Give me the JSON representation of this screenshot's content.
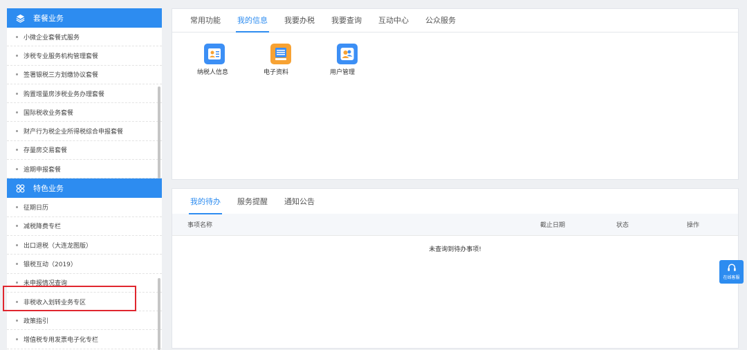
{
  "sidebar": {
    "group1": {
      "title": "套餐业务",
      "items": [
        "小微企业套餐式服务",
        "涉税专业服务机构管理套餐",
        "签署银税三方划缴协议套餐",
        "购置增量房涉税业务办理套餐",
        "国际税收业务套餐",
        "财产行为税企业所得税综合申报套餐",
        "存量房交易套餐",
        "逾期申报套餐"
      ]
    },
    "group2": {
      "title": "特色业务",
      "items": [
        "征期日历",
        "减税降费专栏",
        "出口退税（大连龙图版）",
        "银税互动（2019）",
        "未申报情况查询",
        "非税收入划转业务专区",
        "政策指引",
        "增值税专用发票电子化专栏"
      ]
    }
  },
  "top_panel": {
    "tabs": [
      "常用功能",
      "我的信息",
      "我要办税",
      "我要查询",
      "互动中心",
      "公众服务"
    ],
    "active_tab": "我的信息",
    "apps": [
      {
        "label": "纳税人信息",
        "icon": "id-card-icon"
      },
      {
        "label": "电子资料",
        "icon": "document-stack-icon"
      },
      {
        "label": "用户管理",
        "icon": "users-icon"
      }
    ]
  },
  "bottom_panel": {
    "tabs": [
      "我的待办",
      "服务提醒",
      "通知公告"
    ],
    "active_tab": "我的待办",
    "columns": [
      "事项名称",
      "截止日期",
      "状态",
      "操作"
    ],
    "empty_message": "未查询到待办事项!"
  },
  "float_help": {
    "label": "在线客服",
    "icon": "headset-icon"
  },
  "colors": {
    "accent": "#2d8cf0",
    "highlight": "#e0262e",
    "app_orange": "#f7a233"
  }
}
